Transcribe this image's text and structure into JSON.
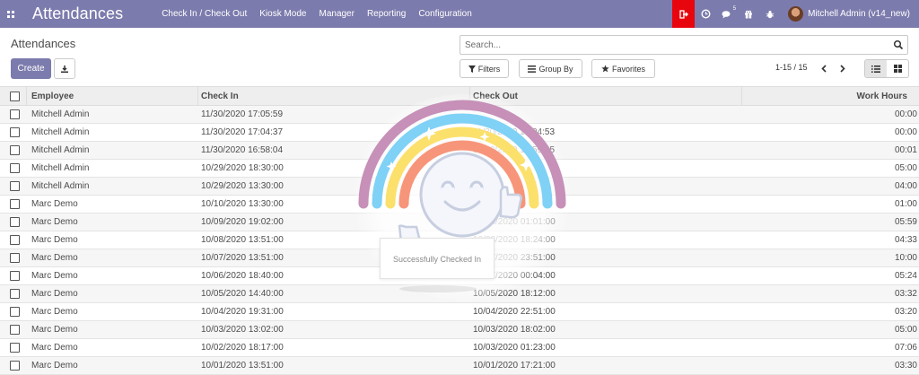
{
  "navbar": {
    "apps_icon": "apps-grid-icon",
    "brand": "Attendances",
    "menu": [
      "Check In / Check Out",
      "Kiosk Mode",
      "Manager",
      "Reporting",
      "Configuration"
    ],
    "checkout_icon": "sign-out-icon",
    "clock_icon": "clock-icon",
    "chat_icon": "comments-icon",
    "chat_count": "5",
    "gift_icon": "gift-icon",
    "bug_icon": "bug-icon",
    "user_name": "Mitchell Admin (v14_new)",
    "accent_color": "#7c7bad",
    "checkout_color": "#e9050d"
  },
  "control": {
    "breadcrumb": "Attendances",
    "create_label": "Create",
    "download_icon": "download-icon",
    "search_placeholder": "Search...",
    "filters_label": "Filters",
    "groupby_label": "Group By",
    "favorites_label": "Favorites",
    "pager": "1-15 / 15"
  },
  "table": {
    "headers": {
      "employee": "Employee",
      "check_in": "Check In",
      "check_out": "Check Out",
      "work_hours": "Work Hours"
    },
    "rows": [
      {
        "employee": "Mitchell Admin",
        "check_in": "11/30/2020 17:05:59",
        "check_out": "",
        "work_hours": "00:00"
      },
      {
        "employee": "Mitchell Admin",
        "check_in": "11/30/2020 17:04:37",
        "check_out": "11/30/2020 17:04:53",
        "work_hours": "00:00"
      },
      {
        "employee": "Mitchell Admin",
        "check_in": "11/30/2020 16:58:04",
        "check_out": "11/30/2020 16:59:05",
        "work_hours": "00:01"
      },
      {
        "employee": "Mitchell Admin",
        "check_in": "10/29/2020 18:30:00",
        "check_out": "",
        "work_hours": "05:00"
      },
      {
        "employee": "Mitchell Admin",
        "check_in": "10/29/2020 13:30:00",
        "check_out": "",
        "work_hours": "04:00"
      },
      {
        "employee": "Marc Demo",
        "check_in": "10/10/2020 13:30:00",
        "check_out": "",
        "work_hours": "01:00"
      },
      {
        "employee": "Marc Demo",
        "check_in": "10/09/2020 19:02:00",
        "check_out": "10/10/2020 01:01:00",
        "work_hours": "05:59"
      },
      {
        "employee": "Marc Demo",
        "check_in": "10/08/2020 13:51:00",
        "check_out": "10/08/2020 18:24:00",
        "work_hours": "04:33"
      },
      {
        "employee": "Marc Demo",
        "check_in": "10/07/2020 13:51:00",
        "check_out": "10/07/2020 23:51:00",
        "work_hours": "10:00"
      },
      {
        "employee": "Marc Demo",
        "check_in": "10/06/2020 18:40:00",
        "check_out": "10/07/2020 00:04:00",
        "work_hours": "05:24"
      },
      {
        "employee": "Marc Demo",
        "check_in": "10/05/2020 14:40:00",
        "check_out": "10/05/2020 18:12:00",
        "work_hours": "03:32"
      },
      {
        "employee": "Marc Demo",
        "check_in": "10/04/2020 19:31:00",
        "check_out": "10/04/2020 22:51:00",
        "work_hours": "03:20"
      },
      {
        "employee": "Marc Demo",
        "check_in": "10/03/2020 13:02:00",
        "check_out": "10/03/2020 18:02:00",
        "work_hours": "05:00"
      },
      {
        "employee": "Marc Demo",
        "check_in": "10/02/2020 18:17:00",
        "check_out": "10/03/2020 01:23:00",
        "work_hours": "07:06"
      },
      {
        "employee": "Marc Demo",
        "check_in": "10/01/2020 13:51:00",
        "check_out": "10/01/2020 17:21:00",
        "work_hours": "03:30"
      }
    ]
  },
  "rainbow": {
    "message": "Successfully Checked In",
    "arc_colors": [
      "#c690b8",
      "#7fd1f5",
      "#fbe06b",
      "#f7957a"
    ]
  }
}
